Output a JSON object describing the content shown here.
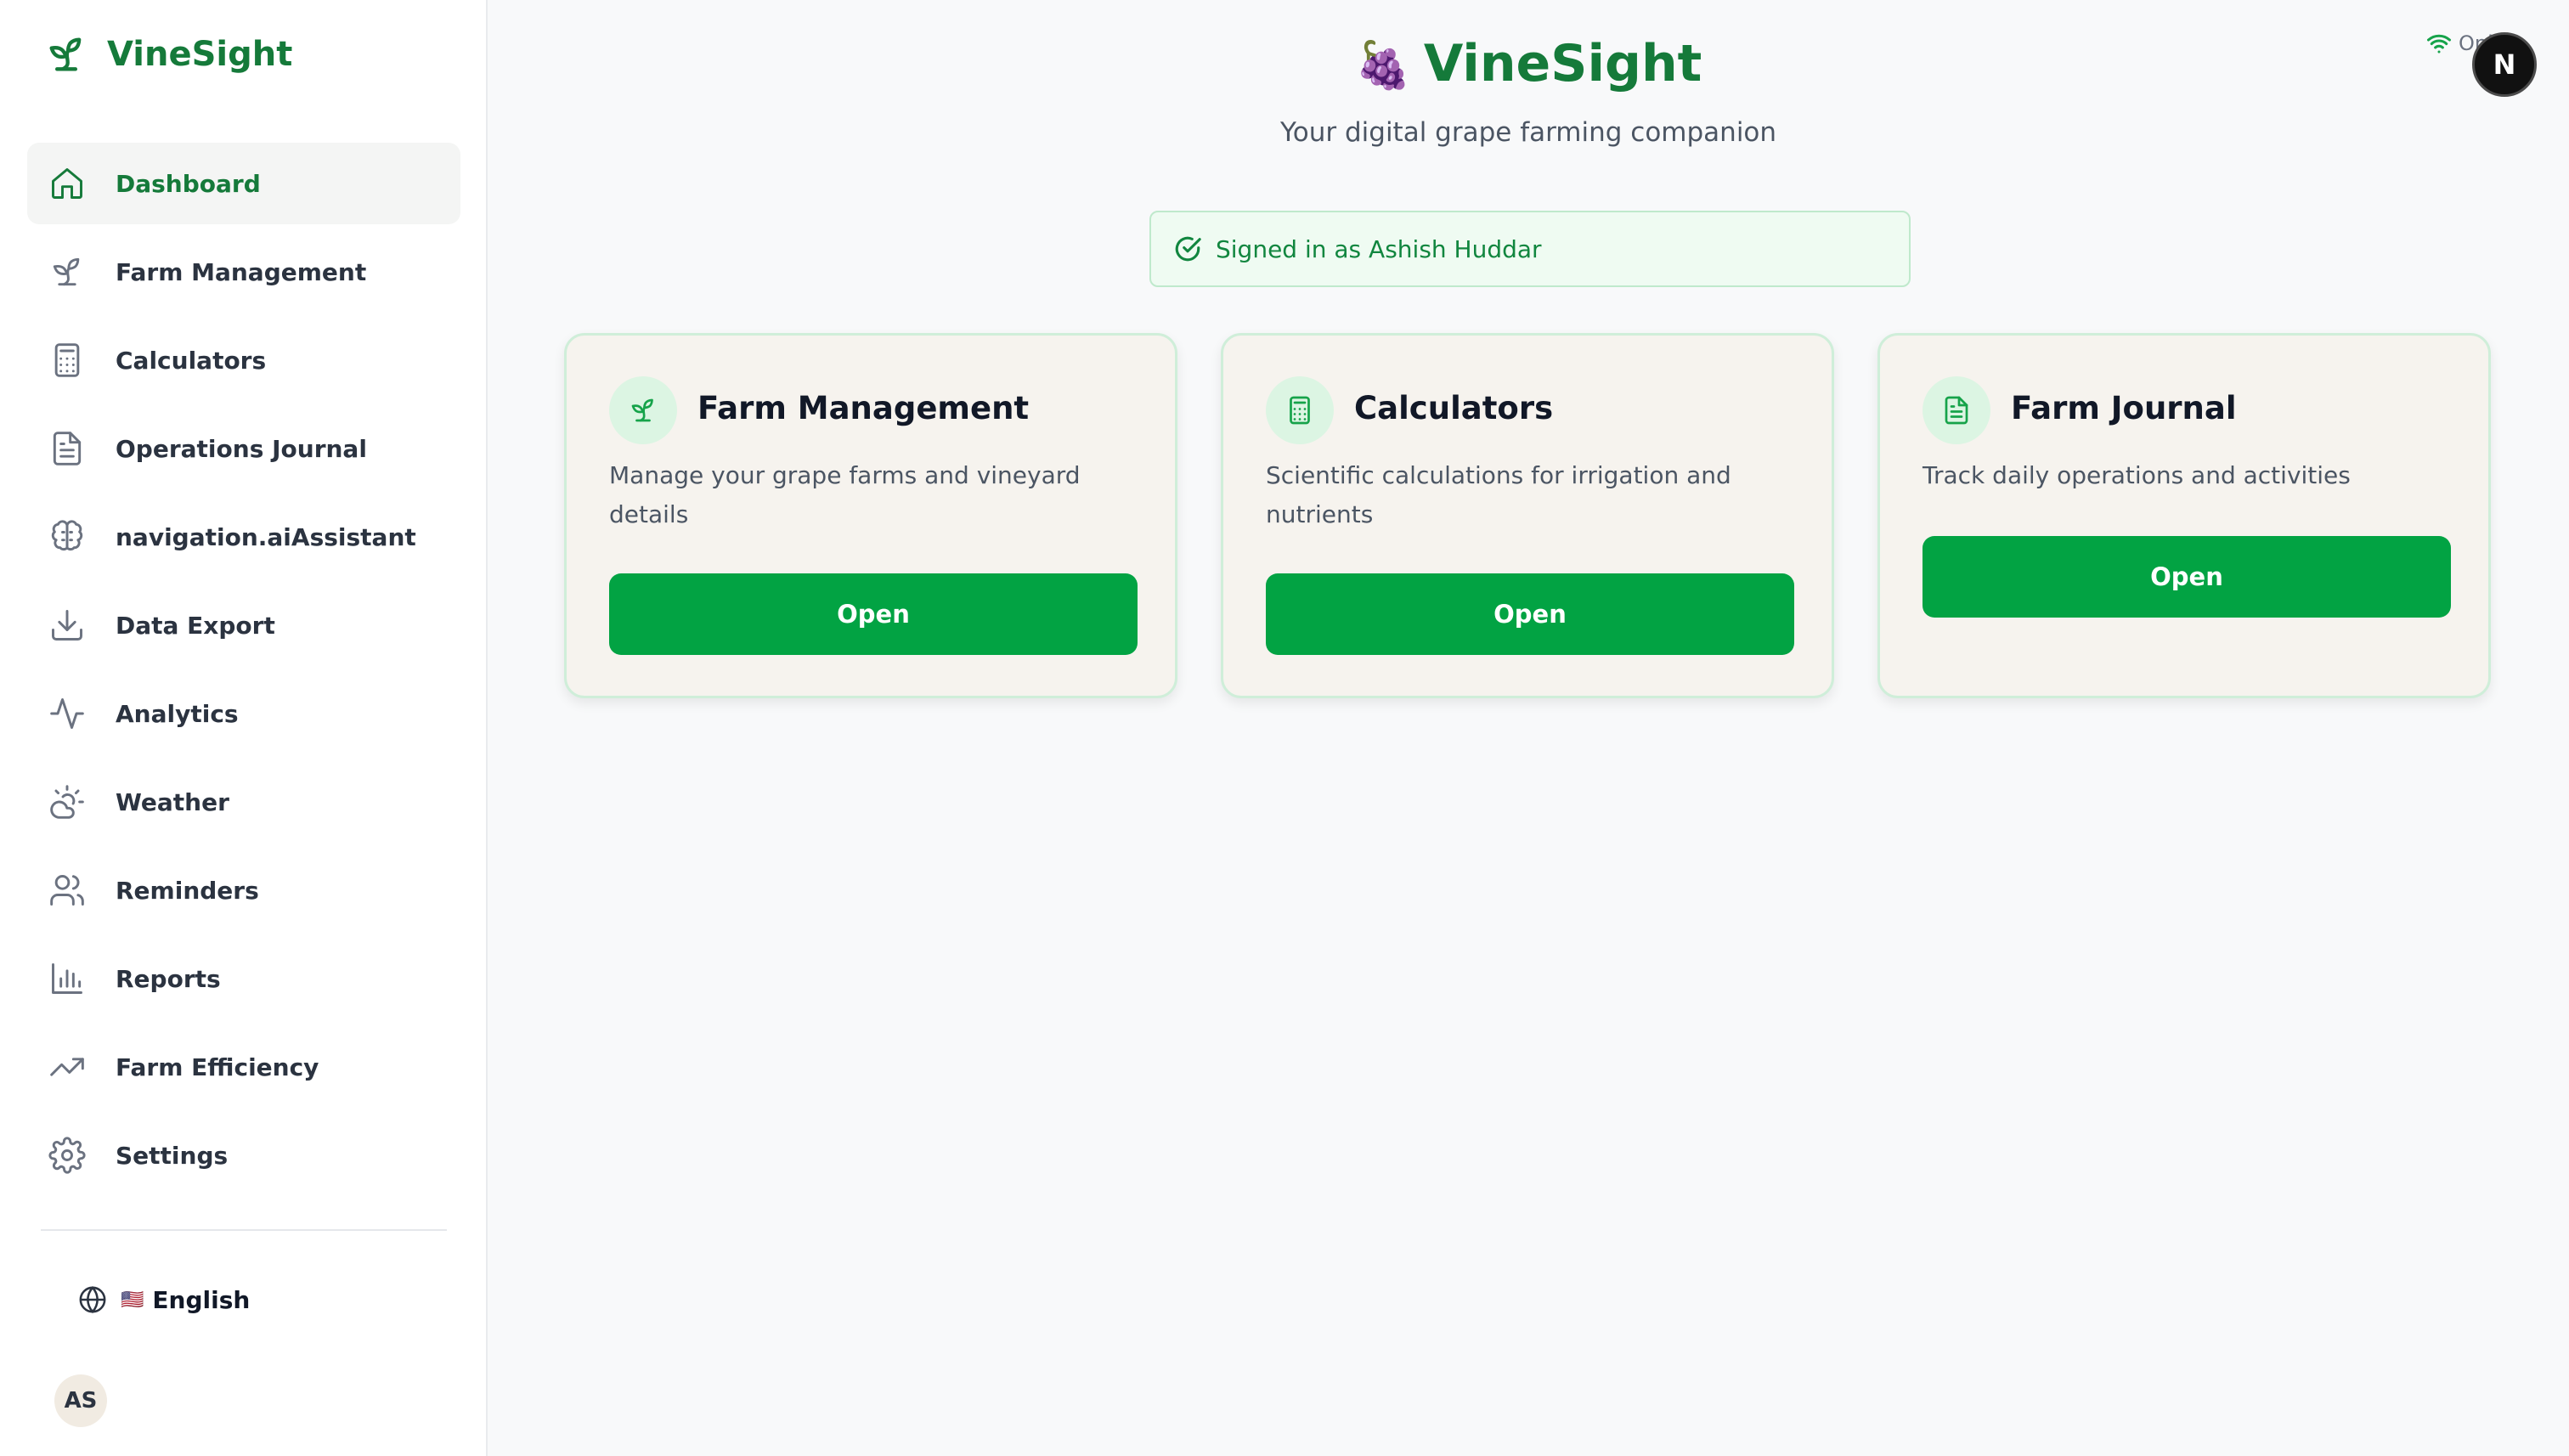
{
  "sidebar": {
    "brand": "VineSight",
    "items": [
      {
        "label": "Dashboard",
        "icon": "home-icon",
        "active": true
      },
      {
        "label": "Farm Management",
        "icon": "sprout-icon"
      },
      {
        "label": "Calculators",
        "icon": "calculator-icon"
      },
      {
        "label": "Operations Journal",
        "icon": "document-icon"
      },
      {
        "label": "navigation.aiAssistant",
        "icon": "brain-icon"
      },
      {
        "label": "Data Export",
        "icon": "download-icon"
      },
      {
        "label": "Analytics",
        "icon": "activity-icon"
      },
      {
        "label": "Weather",
        "icon": "cloud-sun-icon"
      },
      {
        "label": "Reminders",
        "icon": "users-icon"
      },
      {
        "label": "Reports",
        "icon": "bar-chart-icon"
      },
      {
        "label": "Farm Efficiency",
        "icon": "trending-up-icon"
      },
      {
        "label": "Settings",
        "icon": "gear-icon"
      }
    ],
    "language": {
      "flag": "🇺🇸",
      "label": "English"
    },
    "avatar_initials": "AS"
  },
  "header": {
    "title": "VineSight",
    "title_emoji": "🍇",
    "subtitle": "Your digital grape farming companion",
    "signed_in": "Signed in as Ashish Huddar",
    "status": "Online",
    "badge_letter": "N"
  },
  "cards": [
    {
      "title": "Farm Management",
      "description": "Manage your grape farms and vineyard details",
      "button": "Open",
      "icon": "sprout-icon"
    },
    {
      "title": "Calculators",
      "description": "Scientific calculations for irrigation and nutrients",
      "button": "Open",
      "icon": "calculator-icon"
    },
    {
      "title": "Farm Journal",
      "description": "Track daily operations and activities",
      "button": "Open",
      "icon": "document-icon"
    }
  ],
  "colors": {
    "brand": "#157a3a",
    "button": "#02a343",
    "card_bg": "#f6f3ee",
    "signed_bg": "#effbf2"
  }
}
